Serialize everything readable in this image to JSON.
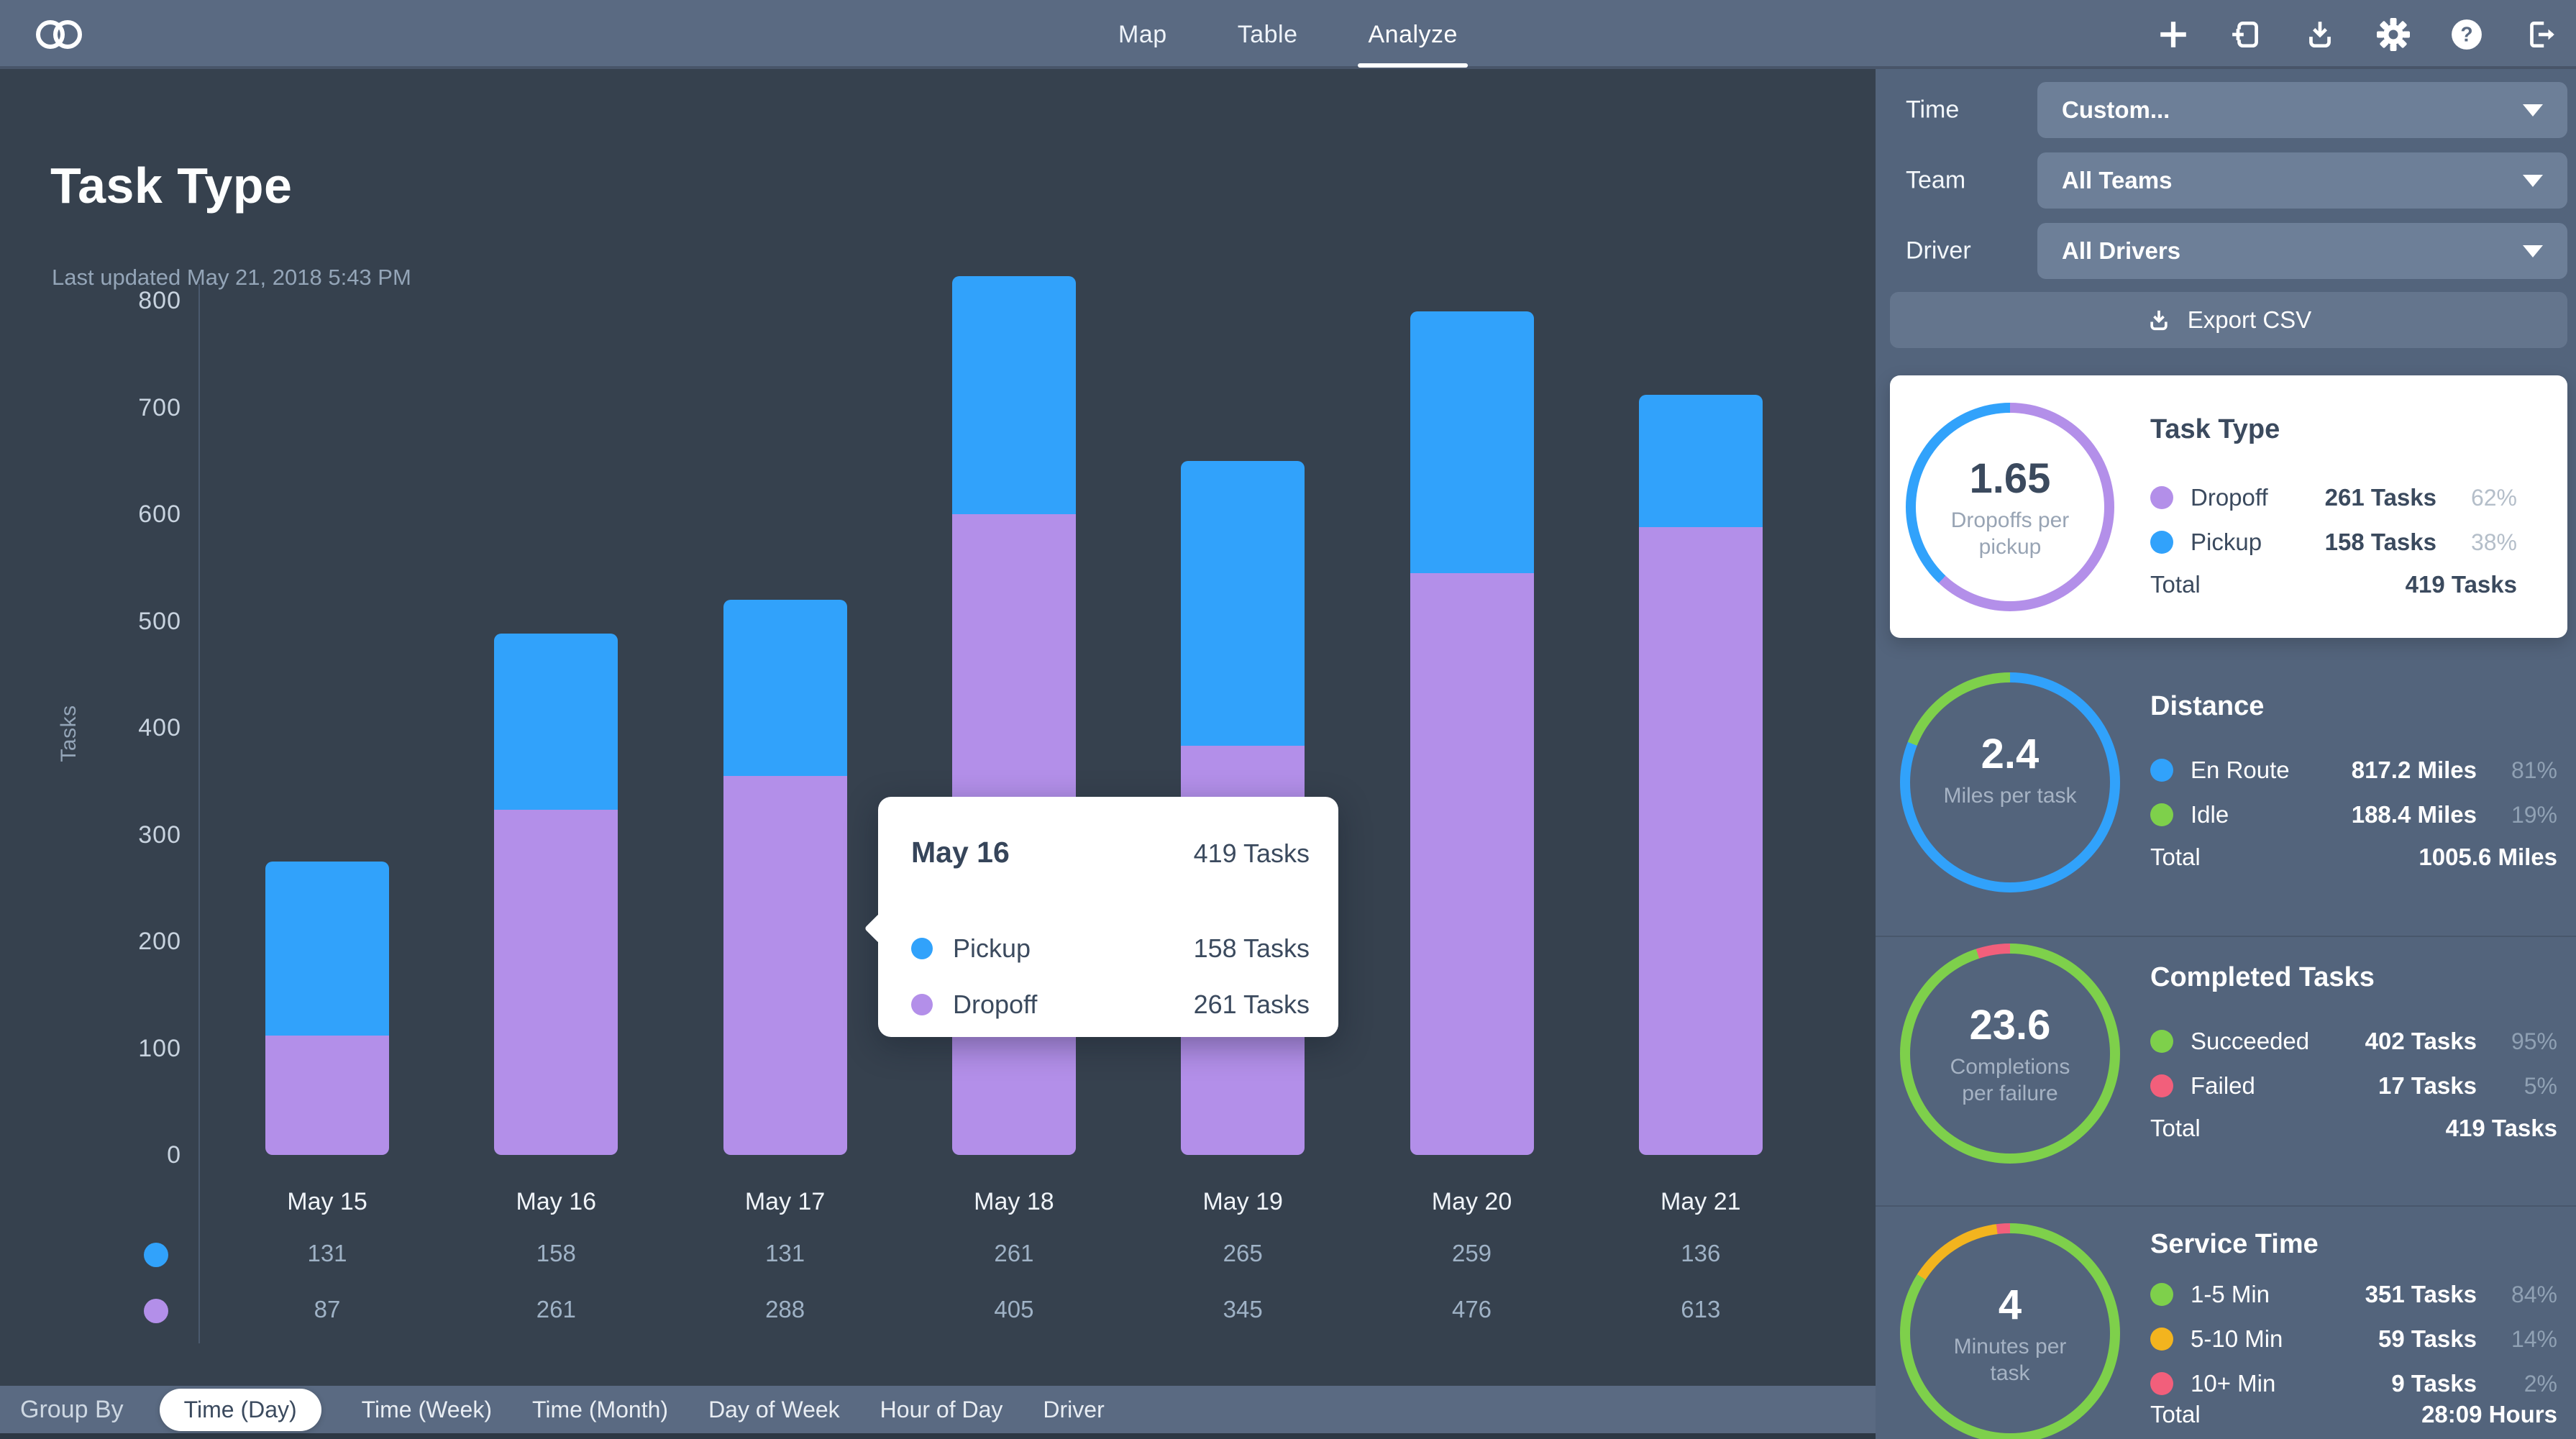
{
  "topbar": {
    "tabs": [
      {
        "label": "Map",
        "active": false
      },
      {
        "label": "Table",
        "active": false
      },
      {
        "label": "Analyze",
        "active": true
      }
    ],
    "icons": [
      "add",
      "import-tasks",
      "download",
      "settings",
      "help",
      "logout"
    ]
  },
  "page": {
    "title": "Task Type",
    "last_updated": "Last updated May 21, 2018 5:43 PM"
  },
  "filters": {
    "rows": [
      {
        "label": "Time",
        "value": "Custom..."
      },
      {
        "label": "Team",
        "value": "All Teams"
      },
      {
        "label": "Driver",
        "value": "All Drivers"
      }
    ],
    "export_label": "Export CSV"
  },
  "chart_data": {
    "type": "bar",
    "stacked": true,
    "title": "Task Type",
    "xlabel": "",
    "ylabel": "Tasks",
    "ylim": [
      0,
      800
    ],
    "ytick_step": 100,
    "grid": false,
    "categories": [
      "May 15",
      "May 16",
      "May 17",
      "May 18",
      "May 19",
      "May 20",
      "May 21"
    ],
    "series": [
      {
        "name": "Pickup",
        "color": "#31a2fb",
        "values": [
          131,
          158,
          131,
          261,
          265,
          259,
          136
        ]
      },
      {
        "name": "Dropoff",
        "color": "#b38fe9",
        "values": [
          87,
          261,
          288,
          405,
          345,
          476,
          613
        ]
      }
    ],
    "stack_order_bottom_to_top": [
      "Dropoff",
      "Pickup"
    ],
    "bars_as_drawn": [
      {
        "dropoff": 112,
        "pickup": 163
      },
      {
        "dropoff": 323,
        "pickup": 165
      },
      {
        "dropoff": 355,
        "pickup": 165
      },
      {
        "dropoff": 600,
        "pickup": 223
      },
      {
        "dropoff": 383,
        "pickup": 267
      },
      {
        "dropoff": 545,
        "pickup": 245
      },
      {
        "dropoff": 588,
        "pickup": 124
      }
    ],
    "tooltip": {
      "category": "May 16",
      "total": "419 Tasks",
      "rows": [
        {
          "label": "Pickup",
          "value": "158 Tasks",
          "color": "#31a2fb"
        },
        {
          "label": "Dropoff",
          "value": "261 Tasks",
          "color": "#b38fe9"
        }
      ]
    }
  },
  "group_by": {
    "label": "Group By",
    "selected": "Time (Day)",
    "options": [
      "Time (Day)",
      "Time (Week)",
      "Time (Month)",
      "Day of Week",
      "Hour of Day",
      "Driver"
    ]
  },
  "cards": [
    {
      "id": "task-type",
      "selected": true,
      "title": "Task Type",
      "metric": {
        "value": "1.65",
        "label": "Dropoffs per pickup"
      },
      "donut": [
        {
          "color": "#b38fe9",
          "pct": 62
        },
        {
          "color": "#31a2fb",
          "pct": 38
        }
      ],
      "rows": [
        {
          "color": "#b38fe9",
          "label": "Dropoff",
          "value": "261 Tasks",
          "pct": "62%"
        },
        {
          "color": "#31a2fb",
          "label": "Pickup",
          "value": "158 Tasks",
          "pct": "38%"
        }
      ],
      "total": {
        "label": "Total",
        "value": "419 Tasks"
      }
    },
    {
      "id": "distance",
      "selected": false,
      "title": "Distance",
      "metric": {
        "value": "2.4",
        "label": "Miles per task"
      },
      "donut": [
        {
          "color": "#31a2fb",
          "pct": 81
        },
        {
          "color": "#7ed04b",
          "pct": 19
        }
      ],
      "rows": [
        {
          "color": "#31a2fb",
          "label": "En Route",
          "value": "817.2 Miles",
          "pct": "81%"
        },
        {
          "color": "#7ed04b",
          "label": "Idle",
          "value": "188.4 Miles",
          "pct": "19%"
        }
      ],
      "total": {
        "label": "Total",
        "value": "1005.6 Miles"
      }
    },
    {
      "id": "completed-tasks",
      "selected": false,
      "title": "Completed Tasks",
      "metric": {
        "value": "23.6",
        "label": "Completions per failure"
      },
      "donut": [
        {
          "color": "#7ed04b",
          "pct": 95
        },
        {
          "color": "#f25f7b",
          "pct": 5
        }
      ],
      "rows": [
        {
          "color": "#7ed04b",
          "label": "Succeeded",
          "value": "402 Tasks",
          "pct": "95%"
        },
        {
          "color": "#f25f7b",
          "label": "Failed",
          "value": "17 Tasks",
          "pct": "5%"
        }
      ],
      "total": {
        "label": "Total",
        "value": "419 Tasks"
      }
    },
    {
      "id": "service-time",
      "selected": false,
      "title": "Service Time",
      "metric": {
        "value": "4",
        "label": "Minutes per task"
      },
      "donut": [
        {
          "color": "#7ed04b",
          "pct": 84
        },
        {
          "color": "#f3b41e",
          "pct": 14
        },
        {
          "color": "#f25f7b",
          "pct": 2
        }
      ],
      "rows": [
        {
          "color": "#7ed04b",
          "label": "1-5 Min",
          "value": "351 Tasks",
          "pct": "84%"
        },
        {
          "color": "#f3b41e",
          "label": "5-10 Min",
          "value": "59 Tasks",
          "pct": "14%"
        },
        {
          "color": "#f25f7b",
          "label": "10+ Min",
          "value": "9 Tasks",
          "pct": "2%"
        }
      ],
      "total": {
        "label": "Total",
        "value": "28:09 Hours"
      }
    }
  ]
}
